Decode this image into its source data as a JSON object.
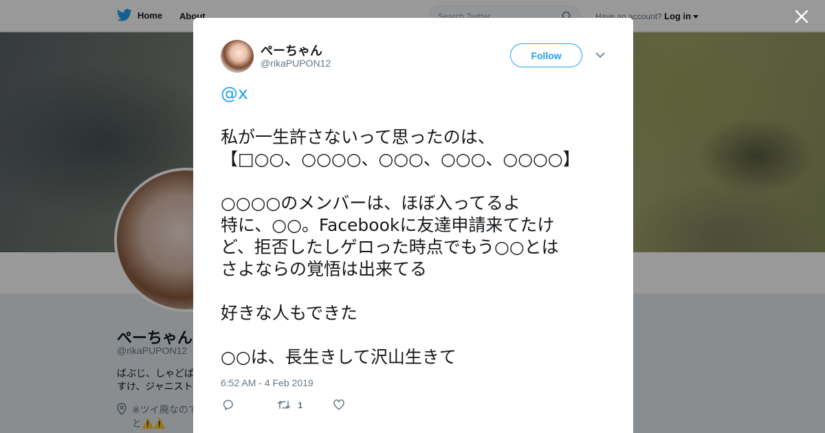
{
  "nav": {
    "home_label": "Home",
    "about_label": "About",
    "search_placeholder": "Search Twitter",
    "account_prompt": "Have an account?",
    "login_label": "Log in"
  },
  "profile": {
    "name": "ぺーちゃん",
    "handle": "@rikaPUPON12",
    "bio_lines": [
      "ばぶじ、しゃどば",
      "すけ、ジャニスト"
    ],
    "location_lines": [
      "※ツイ廃なので",
      "と⚠️⚠️"
    ]
  },
  "tweet": {
    "author_name": "ぺーちゃん",
    "author_handle": "@rikaPUPON12",
    "follow_label": "Follow",
    "mention": "@x",
    "lines": [
      "",
      "私が一生許さないって思ったのは、",
      "【□○○、○○○○、○○○、○○○、○○○○】",
      "",
      "○○○○のメンバーは、ほぼ入ってるよ",
      "特に、○○。Facebookに友達申請来てたけ",
      "ど、拒否したしゲロった時点でもう○○とは",
      "さよならの覚悟は出来てる",
      "",
      "好きな人もできた",
      "",
      "○○は、長生きして沢山生きて"
    ],
    "timestamp": "6:52 AM - 4 Feb 2019",
    "retweet_count": "1"
  },
  "icons": {
    "brand": "twitter-bird-icon",
    "close": "close-icon",
    "reply": "reply-icon",
    "retweet": "retweet-icon",
    "like": "heart-icon",
    "caret": "chevron-down-icon",
    "search": "search-icon",
    "location": "location-pin-icon"
  },
  "colors": {
    "accent": "#1da1f2",
    "text": "#14171a",
    "muted": "#657786"
  }
}
